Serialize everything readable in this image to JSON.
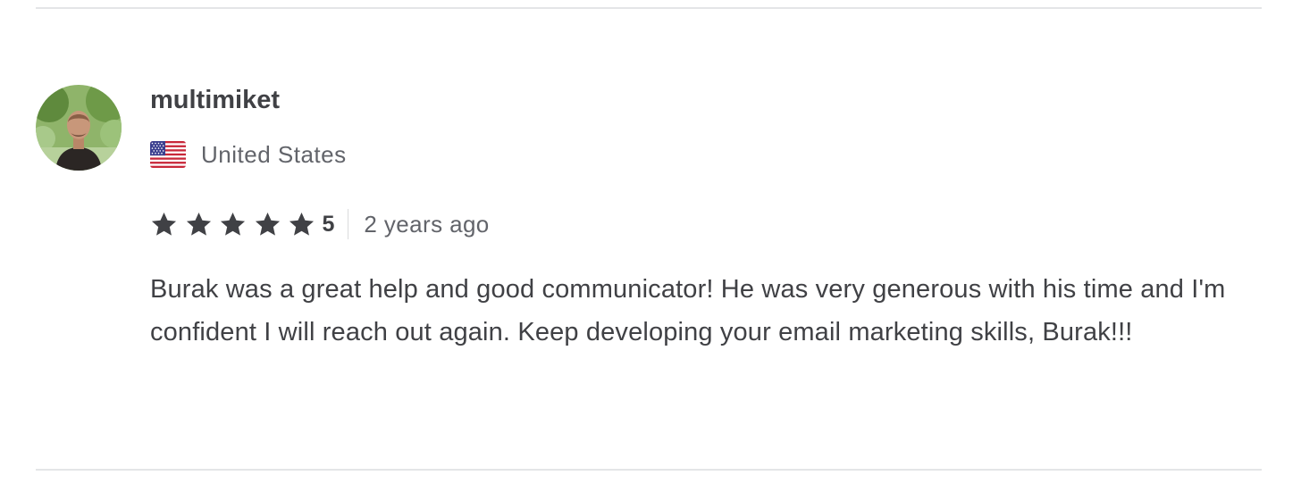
{
  "review": {
    "username": "multimiket",
    "country": "United States",
    "flag_icon": "us-flag-icon",
    "avatar_icon": "user-avatar",
    "rating": 5,
    "rating_label": "5",
    "stars_filled": 5,
    "time_ago": "2 years ago",
    "text": "Burak was a great help and good communicator! He was very generous with his time and I'm confident I will reach out again. Keep developing your email marketing skills, Burak!!!"
  },
  "colors": {
    "text_primary": "#404145",
    "text_secondary": "#62646a",
    "star": "#404145",
    "divider": "#e4e5e7"
  }
}
